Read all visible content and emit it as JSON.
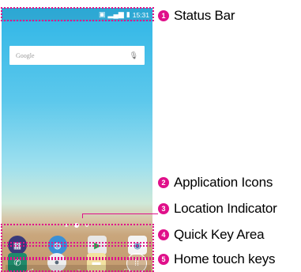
{
  "phone": {
    "status_bar": {
      "time": "15:31"
    },
    "search": {
      "placeholder": "Google"
    },
    "apps": [
      {
        "icon": "folder-apps-icon"
      },
      {
        "icon": "globe-icon"
      },
      {
        "icon": "play-store-icon"
      },
      {
        "icon": "camera-icon"
      }
    ],
    "quick_keys": [
      {
        "icon": "phone-icon"
      },
      {
        "icon": "contacts-icon"
      },
      {
        "icon": "messaging-icon"
      },
      {
        "icon": "apps-grid-icon"
      }
    ],
    "home_keys": [
      {
        "icon": "back-icon"
      },
      {
        "icon": "home-icon"
      },
      {
        "icon": "recent-apps-icon"
      }
    ]
  },
  "callouts": [
    {
      "number": "1",
      "label": "Status Bar"
    },
    {
      "number": "2",
      "label": "Application Icons"
    },
    {
      "number": "3",
      "label": "Location Indicator"
    },
    {
      "number": "4",
      "label": "Quick Key Area"
    },
    {
      "number": "5",
      "label": "Home touch keys"
    }
  ],
  "colors": {
    "accent": "#e0108a",
    "sky": "#2fb6e6"
  }
}
